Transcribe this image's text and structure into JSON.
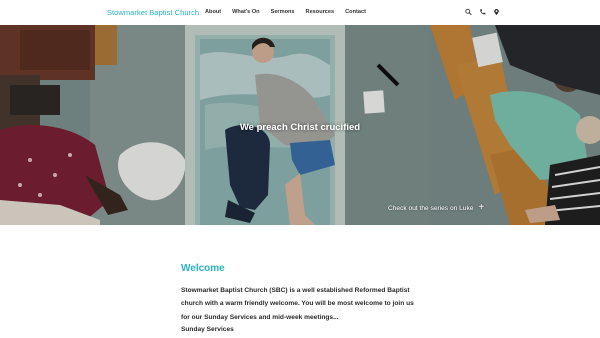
{
  "header": {
    "brand": "Stowmarket Baptist Church",
    "nav": [
      "About",
      "What's On",
      "Sermons",
      "Resources",
      "Contact"
    ],
    "icons": [
      "search-icon",
      "phone-icon",
      "map-pin-icon"
    ]
  },
  "hero": {
    "title": "We preach Christ crucified",
    "link_label": "Check out the series on Luke",
    "link_icon": "plus-icon"
  },
  "main": {
    "heading": "Welcome",
    "intro": "Stowmarket Baptist Church (SBC) is a well established Reformed Baptist church with a warm friendly welcome. You will be most welcome to join us for our Sunday Services and mid-week meetings...",
    "section_title": "Sunday Services"
  },
  "colors": {
    "accent": "#2bb3c0",
    "text": "#2a2a2a",
    "background": "#ffffff"
  }
}
